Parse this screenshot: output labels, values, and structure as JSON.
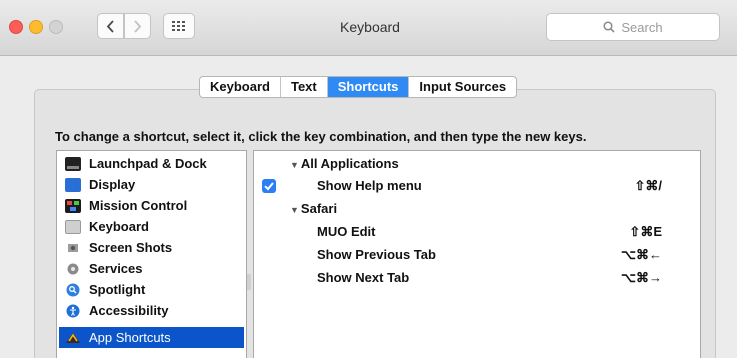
{
  "window": {
    "title": "Keyboard",
    "search_placeholder": "Search"
  },
  "tabs": [
    {
      "label": "Keyboard",
      "active": false
    },
    {
      "label": "Text",
      "active": false
    },
    {
      "label": "Shortcuts",
      "active": true
    },
    {
      "label": "Input Sources",
      "active": false
    }
  ],
  "instruction": "To change a shortcut, select it, click the key combination, and then type the new keys.",
  "categories": [
    {
      "label": "Launchpad & Dock",
      "icon": "launchpad-dock-icon",
      "selected": false
    },
    {
      "label": "Display",
      "icon": "display-icon",
      "selected": false
    },
    {
      "label": "Mission Control",
      "icon": "mission-control-icon",
      "selected": false
    },
    {
      "label": "Keyboard",
      "icon": "keyboard-icon",
      "selected": false
    },
    {
      "label": "Screen Shots",
      "icon": "screenshots-icon",
      "selected": false
    },
    {
      "label": "Services",
      "icon": "services-gear-icon",
      "selected": false
    },
    {
      "label": "Spotlight",
      "icon": "spotlight-icon",
      "selected": false
    },
    {
      "label": "Accessibility",
      "icon": "accessibility-icon",
      "selected": false
    },
    {
      "label": "App Shortcuts",
      "icon": "app-shortcuts-icon",
      "selected": true
    }
  ],
  "shortcuts": {
    "group1": {
      "label": "All Applications"
    },
    "help": {
      "label": "Show Help menu",
      "key": "⇧⌘/",
      "checked": true
    },
    "group2": {
      "label": "Safari"
    },
    "muo": {
      "label": "MUO Edit",
      "key": "⇧⌘E"
    },
    "prev": {
      "label": "Show Previous Tab",
      "key": "⌥⌘←"
    },
    "next": {
      "label": "Show Next Tab",
      "key": "⌥⌘→"
    }
  },
  "colors": {
    "accent": "#2f8bf3",
    "selection": "#0b54c9",
    "close": "#fc5d56",
    "minimize": "#fdbb2d"
  }
}
